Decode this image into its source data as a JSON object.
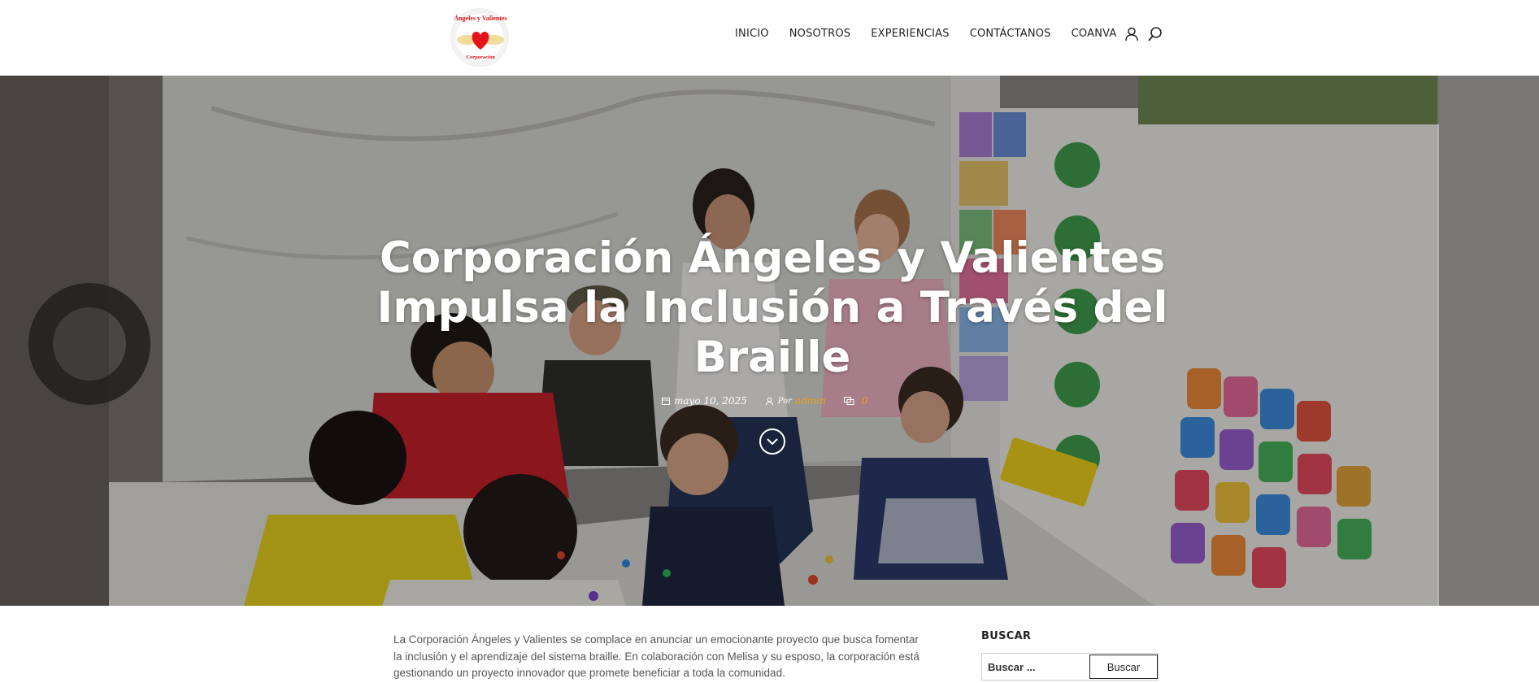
{
  "logo": {
    "top_text": "Ángeles y Valientes",
    "bottom_text": "Corporación",
    "heart_color": "#e5141b",
    "wing_color": "#f2d48a"
  },
  "nav": {
    "items": [
      {
        "label": "INICIO"
      },
      {
        "label": "NOSOTROS"
      },
      {
        "label": "EXPERIENCIAS"
      },
      {
        "label": "CONTÁCTANOS"
      },
      {
        "label": "COANVA"
      }
    ],
    "icons": [
      "user-icon",
      "search-icon"
    ]
  },
  "hero": {
    "title": "Corporación Ángeles y Valientes Impulsa la Inclusión a Través del Braille",
    "date": "mayo 10, 2025",
    "author_prefix": "Por",
    "author": "admin",
    "comments": "0",
    "accent_color": "#f0a21b"
  },
  "article": {
    "intro": "La Corporación Ángeles y Valientes se complace en anunciar un emocionante proyecto que busca fomentar la inclusión y el aprendizaje del sistema braille. En colaboración con Melisa y su esposo, la corporación está gestionando un proyecto innovador que promete beneficiar a toda la comunidad."
  },
  "sidebar": {
    "search_title": "BUSCAR",
    "search_placeholder": "Buscar ...",
    "search_button": "Buscar"
  }
}
